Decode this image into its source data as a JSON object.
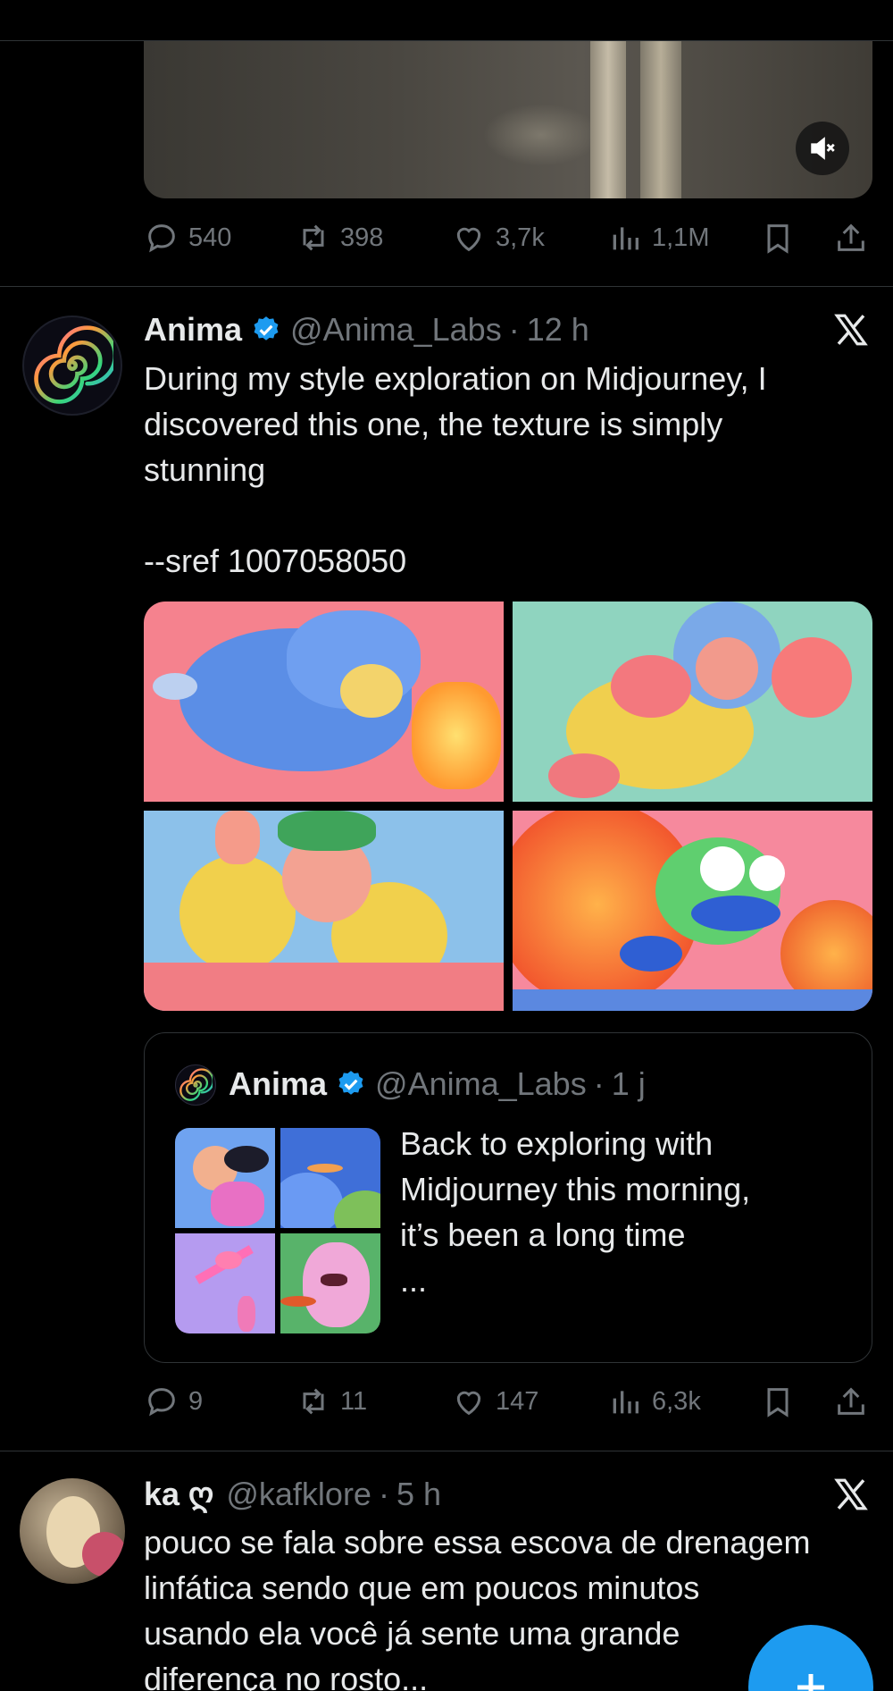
{
  "top_tweet": {
    "stats": {
      "replies": "540",
      "reposts": "398",
      "likes": "3,7k",
      "views": "1,1M"
    }
  },
  "tweet": {
    "name": "Anima",
    "handle": "@Anima_Labs",
    "separator": "·",
    "time": "12 h",
    "text_lines": [
      "During my style exploration on Midjourney, I",
      "discovered this one, the texture is simply",
      "stunning"
    ],
    "sref": "--sref 1007058050",
    "quote": {
      "name": "Anima",
      "handle": "@Anima_Labs",
      "separator": "·",
      "time": "1 j",
      "text_lines": [
        "Back to exploring with",
        "Midjourney this morning,",
        "it’s been a long time",
        "..."
      ]
    },
    "stats": {
      "replies": "9",
      "reposts": "11",
      "likes": "147",
      "views": "6,3k"
    }
  },
  "next_tweet": {
    "name": "ka ღ",
    "handle": "@kafklore",
    "separator": "·",
    "time": "5 h",
    "text_lines": [
      "pouco se fala sobre essa escova de drenagem",
      "linfática sendo que em poucos minutos",
      "usando ela você já sente uma grande",
      "diferença no rosto..."
    ]
  },
  "icons": [
    "reply-icon",
    "repost-icon",
    "like-icon",
    "views-icon",
    "bookmark-icon",
    "share-icon",
    "x-logo-icon",
    "verified-badge-icon",
    "mute-icon",
    "compose-plus-icon"
  ],
  "colors": {
    "background": "#000000",
    "text": "#e7e9ea",
    "muted": "#71767b",
    "accent": "#1d9bf0",
    "divider": "#2f3336"
  }
}
